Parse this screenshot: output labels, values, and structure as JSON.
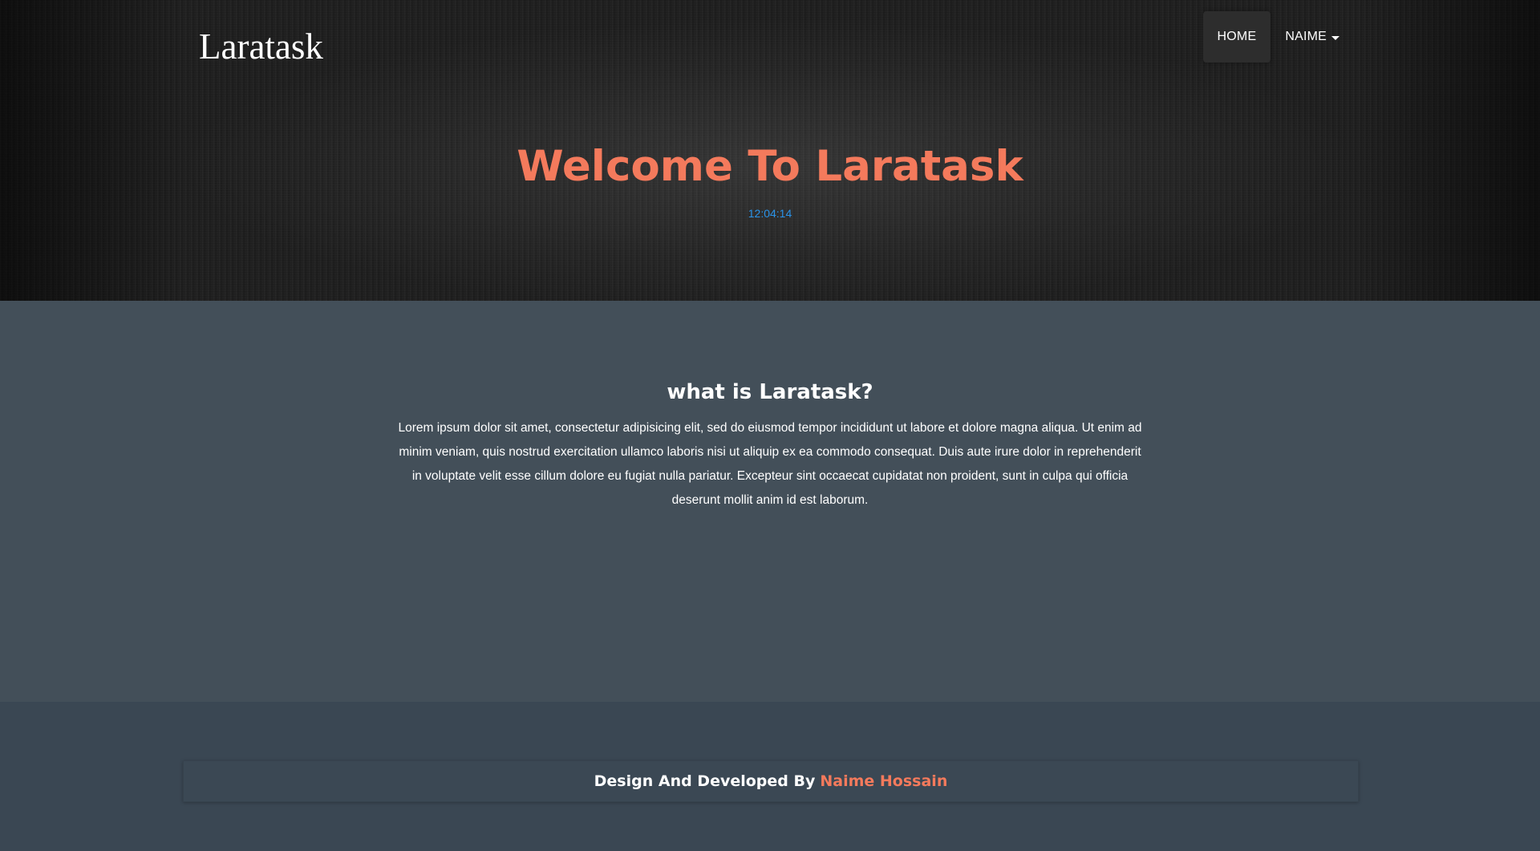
{
  "header": {
    "brand": "Laratask",
    "nav": [
      {
        "label": "HOME",
        "active": true
      },
      {
        "label": "NAIME",
        "active": false,
        "dropdown": true
      }
    ]
  },
  "hero": {
    "title": "Welcome To Laratask",
    "clock": "12:04:14"
  },
  "about": {
    "title": "what is Laratask?",
    "text": "Lorem ipsum dolor sit amet, consectetur adipisicing elit, sed do eiusmod tempor incididunt ut labore et dolore magna aliqua. Ut enim ad minim veniam, quis nostrud exercitation ullamco laboris nisi ut aliquip ex ea commodo consequat. Duis aute irure dolor in reprehenderit in voluptate velit esse cillum dolore eu fugiat nulla pariatur. Excepteur sint occaecat cupidatat non proident, sunt in culpa qui officia deserunt mollit anim id est laborum."
  },
  "footer": {
    "credit_prefix": "Design And Developed By",
    "author": "Naime Hossain"
  },
  "colors": {
    "accent": "#f47a5c",
    "clock": "#2a93e8",
    "about_bg": "#434f59",
    "footer_bg": "#3a4753"
  },
  "icons": {
    "dropdown": "caret-down-icon"
  }
}
